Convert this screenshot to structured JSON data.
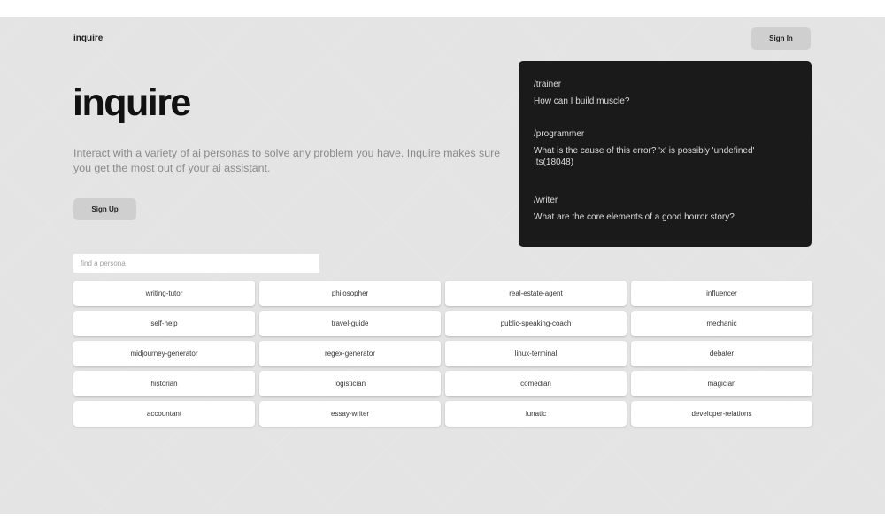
{
  "header": {
    "logo": "inquire",
    "sign_in_label": "Sign In"
  },
  "hero": {
    "title": "inquire",
    "description": "Interact with a variety of ai personas to solve any problem you have. Inquire makes sure you get the most out of your ai assistant.",
    "sign_up_label": "Sign Up"
  },
  "examples": [
    {
      "command": "/trainer",
      "question": "How can I build muscle?"
    },
    {
      "command": "/programmer",
      "question": "What is the cause of this error? 'x' is possibly 'undefined' .ts(18048)"
    },
    {
      "command": "/writer",
      "question": "What are the core elements of a good horror story?"
    }
  ],
  "search": {
    "placeholder": "find a persona",
    "value": ""
  },
  "personas": [
    "writing-tutor",
    "philosopher",
    "real-estate-agent",
    "influencer",
    "self-help",
    "travel-guide",
    "public-speaking-coach",
    "mechanic",
    "midjourney-generator",
    "regex-generator",
    "linux-terminal",
    "debater",
    "historian",
    "logistician",
    "comedian",
    "magician",
    "accountant",
    "essay-writer",
    "lunatic",
    "developer-relations"
  ],
  "colors": {
    "page_background": "#e4e4e4",
    "panel_background": "#1a1a1a",
    "button_background": "#cfcfcf",
    "card_background": "#ffffff"
  }
}
